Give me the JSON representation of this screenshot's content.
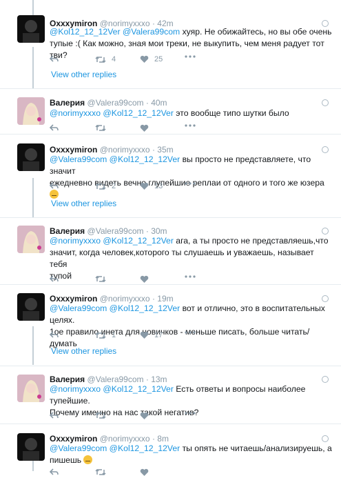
{
  "view_other_replies": "View other replies",
  "tweets": [
    {
      "name": "Oxxxymiron",
      "handle": "@norimyxxxo",
      "time": "· 42m",
      "m1": "@Kol12_12_12Ver",
      "m2": "@Valera99com",
      "line1": " хуяр. Не обижайтесь, но вы обе очень",
      "line2": "тупые :( Как можно, зная мои треки, не выкупить, чем меня радует тот тви?",
      "retweets": "4",
      "likes": "25"
    },
    {
      "name": "Валерия",
      "handle": "@Valera99com",
      "time": "· 40m",
      "m1": "@norimyxxxo",
      "m2": "@Kol12_12_12Ver",
      "line1": " это вообще типо шутки было"
    },
    {
      "name": "Oxxxymiron",
      "handle": "@norimyxxxo",
      "time": "· 35m",
      "m1": "@Valera99com",
      "m2": "@Kol12_12_12Ver",
      "line1": " вы просто не представляете, что значит",
      "line2": "ежедневно видеть вечно глупейшие реплаи от одного и того же юзера ",
      "retweets": "2",
      "likes": "13"
    },
    {
      "name": "Валерия",
      "handle": "@Valera99com",
      "time": "· 30m",
      "m1": "@norimyxxxo",
      "m2": "@Kol12_12_12Ver",
      "line1": " ага, а ты просто не представляешь,что",
      "line2": "значит, когда человек,которого ты слушаешь и уважаешь, называет тебя",
      "line3": "тупой"
    },
    {
      "name": "Oxxxymiron",
      "handle": "@norimyxxxo",
      "time": "· 19m",
      "m1": "@Valera99com",
      "m2": "@Kol12_12_12Ver",
      "line1": " вот и отлично, это в воспитательных целях.",
      "line2": "1ое правило инета для новичков - меньше писать, больше читать/думать",
      "retweets": "1",
      "likes": "17"
    },
    {
      "name": "Валерия",
      "handle": "@Valera99com",
      "time": "· 13m",
      "m1": "@norimyxxxo",
      "m2": "@Kol12_12_12Ver",
      "line1": " Есть ответы и вопросы наиболее тупейшие.",
      "line2": "Почему именно на нас такой негатив?"
    },
    {
      "name": "Oxxxymiron",
      "handle": "@norimyxxxo",
      "time": "· 8m",
      "m1": "@Valera99com",
      "m2": "@Kol12_12_12Ver",
      "line1": " ты опять не читаешь/анализируешь, а",
      "line2": "пишешь "
    }
  ]
}
